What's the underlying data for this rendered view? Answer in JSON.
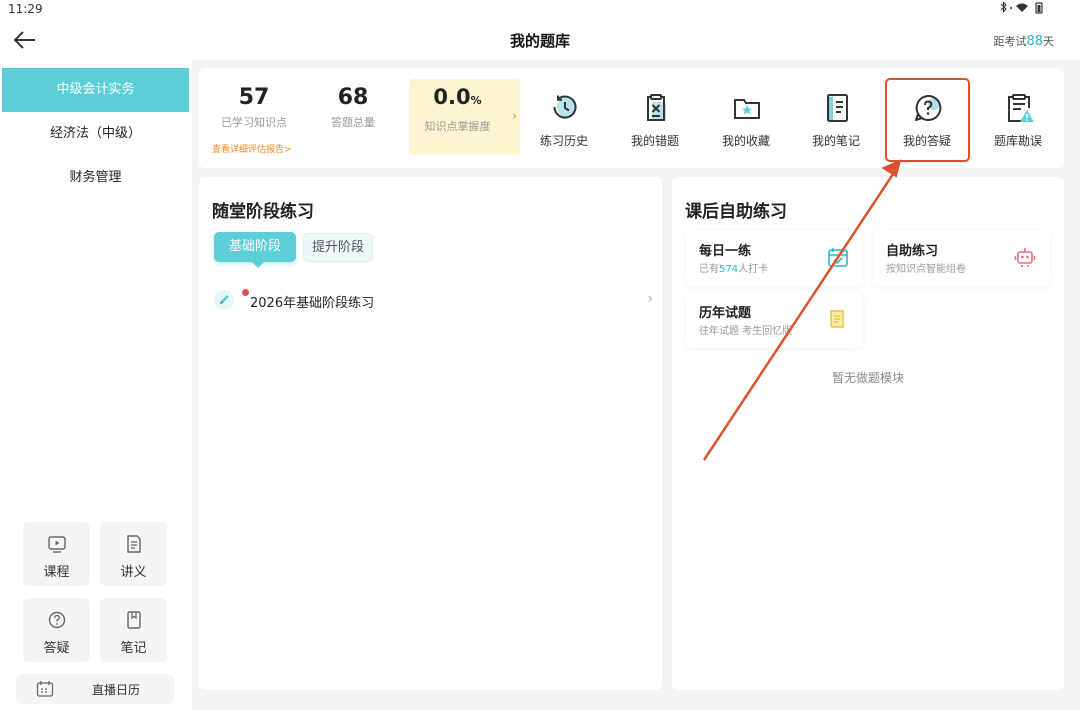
{
  "status_bar": {
    "time": "11:29"
  },
  "header": {
    "title": "我的题库",
    "countdown_prefix": "距考试",
    "countdown_days": "88",
    "countdown_suffix": "天"
  },
  "sidebar": {
    "subjects": [
      {
        "label": "中级会计实务",
        "active": true
      },
      {
        "label": "经济法（中级）",
        "active": false
      },
      {
        "label": "财务管理",
        "active": false
      }
    ],
    "tools": [
      {
        "label": "课程",
        "icon": "video-icon"
      },
      {
        "label": "讲义",
        "icon": "document-icon"
      },
      {
        "label": "答疑",
        "icon": "question-icon"
      },
      {
        "label": "笔记",
        "icon": "notebook-icon"
      }
    ],
    "calendar": {
      "label": "直播日历",
      "icon": "calendar-icon"
    }
  },
  "stats": {
    "learned": {
      "value": "57",
      "label": "已学习知识点"
    },
    "total": {
      "value": "68",
      "label": "答题总量"
    },
    "report_link": "查看详细评估报告>",
    "mastery": {
      "value": "0.0",
      "unit": "%",
      "label": "知识点掌握度"
    }
  },
  "functions": [
    {
      "label": "练习历史",
      "icon": "history-icon"
    },
    {
      "label": "我的错题",
      "icon": "wrong-questions-icon"
    },
    {
      "label": "我的收藏",
      "icon": "favorites-icon"
    },
    {
      "label": "我的笔记",
      "icon": "notes-icon"
    },
    {
      "label": "我的答疑",
      "icon": "qa-icon"
    },
    {
      "label": "题库勘误",
      "icon": "errata-icon"
    }
  ],
  "stage_practice": {
    "title": "随堂阶段练习",
    "tabs": [
      {
        "label": "基础阶段",
        "active": true
      },
      {
        "label": "提升阶段",
        "active": false
      }
    ],
    "items": [
      {
        "label": "2026年基础阶段练习",
        "new": true
      }
    ]
  },
  "self_practice": {
    "title": "课后自助练习",
    "cards": [
      {
        "title": "每日一练",
        "sub_prefix": "已有",
        "sub_highlight": "574",
        "sub_suffix": "人打卡",
        "icon": "calendar-check-icon"
      },
      {
        "title": "自助练习",
        "sub": "按知识点智能组卷",
        "icon": "robot-icon"
      },
      {
        "title": "历年试题",
        "sub": "往年试题 考生回忆版",
        "icon": "paper-icon"
      }
    ],
    "empty_text": "暂无做题模块"
  },
  "colors": {
    "accent": "#5ccfd6",
    "highlight": "#d9532f",
    "link_orange": "#f08a24",
    "mastery_bg": "#fdf5d0"
  }
}
